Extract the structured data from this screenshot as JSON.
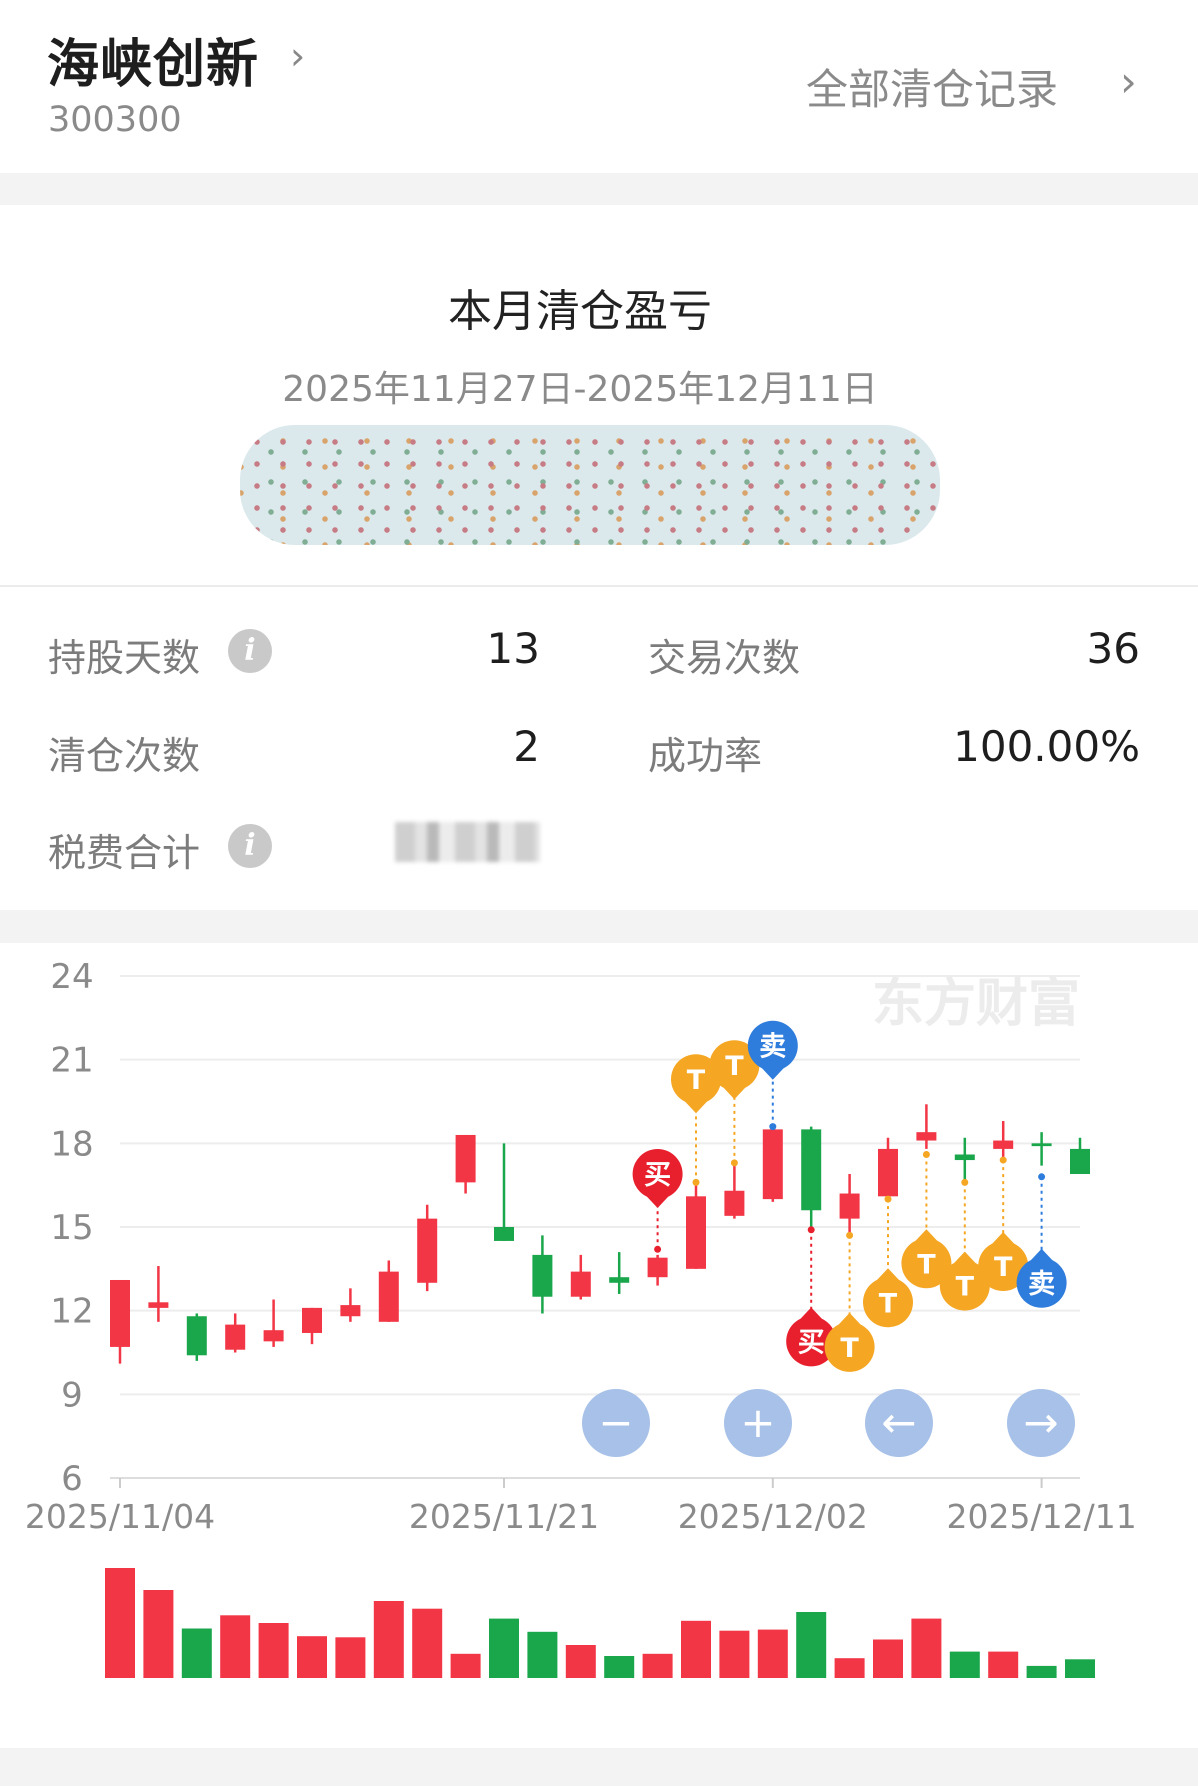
{
  "header": {
    "stock_name": "海峡创新",
    "stock_code": "300300",
    "all_records_link": "全部清仓记录",
    "chevron": "›"
  },
  "summary": {
    "title": "本月清仓盈亏",
    "date_range": "2025年11月27日-2025年12月11日"
  },
  "stats": {
    "holding_days_label": "持股天数",
    "holding_days": "13",
    "trade_count_label": "交易次数",
    "trade_count": "36",
    "clear_count_label": "清仓次数",
    "clear_count": "2",
    "success_rate_label": "成功率",
    "success_rate": "100.00%",
    "fees_label": "税费合计",
    "info_icon": "i"
  },
  "chart": {
    "watermark": "东方财富",
    "buy_label": "买",
    "sell_label": "卖",
    "t_label": "T",
    "colors": {
      "up": "#f23645",
      "down": "#1aa64b",
      "buy": "#e8202e",
      "sell": "#2e7cdc",
      "t": "#f5a623",
      "control": "#a7c1e8"
    },
    "controls": [
      {
        "name": "zoom-out-icon",
        "glyph": "−"
      },
      {
        "name": "zoom-in-icon",
        "glyph": "+"
      },
      {
        "name": "arrow-left-icon",
        "glyph": "←"
      },
      {
        "name": "arrow-right-icon",
        "glyph": "→"
      }
    ]
  },
  "chart_data": {
    "type": "candlestick",
    "ylim": [
      6,
      24
    ],
    "y_ticks": [
      24,
      21,
      18,
      15,
      12,
      9,
      6
    ],
    "x_tick_labels": [
      {
        "index": 0,
        "label": "2025/11/04"
      },
      {
        "index": 10,
        "label": "2025/11/21"
      },
      {
        "index": 17,
        "label": "2025/12/02"
      },
      {
        "index": 24,
        "label": "2025/12/11"
      }
    ],
    "candles": [
      {
        "o": 10.7,
        "c": 13.1,
        "h": 13.1,
        "l": 10.1
      },
      {
        "o": 12.1,
        "c": 12.3,
        "h": 13.6,
        "l": 11.6
      },
      {
        "o": 11.8,
        "c": 10.4,
        "h": 11.9,
        "l": 10.2
      },
      {
        "o": 10.6,
        "c": 11.5,
        "h": 11.9,
        "l": 10.5
      },
      {
        "o": 10.9,
        "c": 11.3,
        "h": 12.4,
        "l": 10.7
      },
      {
        "o": 11.2,
        "c": 12.1,
        "h": 12.1,
        "l": 10.8
      },
      {
        "o": 11.8,
        "c": 12.2,
        "h": 12.8,
        "l": 11.6
      },
      {
        "o": 11.6,
        "c": 13.4,
        "h": 13.8,
        "l": 11.6
      },
      {
        "o": 13.0,
        "c": 15.3,
        "h": 15.8,
        "l": 12.7
      },
      {
        "o": 16.6,
        "c": 18.3,
        "h": 18.3,
        "l": 16.2
      },
      {
        "o": 15.0,
        "c": 14.5,
        "h": 18.0,
        "l": 14.5
      },
      {
        "o": 14.0,
        "c": 12.5,
        "h": 14.7,
        "l": 11.9
      },
      {
        "o": 12.5,
        "c": 13.4,
        "h": 14.0,
        "l": 12.4
      },
      {
        "o": 13.2,
        "c": 13.0,
        "h": 14.1,
        "l": 12.6
      },
      {
        "o": 13.2,
        "c": 13.9,
        "h": 14.0,
        "l": 12.9
      },
      {
        "o": 13.5,
        "c": 16.1,
        "h": 16.6,
        "l": 13.5
      },
      {
        "o": 15.4,
        "c": 16.3,
        "h": 17.3,
        "l": 15.3
      },
      {
        "o": 16.0,
        "c": 18.5,
        "h": 18.7,
        "l": 15.9
      },
      {
        "o": 18.5,
        "c": 15.6,
        "h": 18.6,
        "l": 14.8
      },
      {
        "o": 15.3,
        "c": 16.2,
        "h": 16.9,
        "l": 14.6
      },
      {
        "o": 16.1,
        "c": 17.8,
        "h": 18.2,
        "l": 15.9
      },
      {
        "o": 18.1,
        "c": 18.4,
        "h": 19.4,
        "l": 17.8
      },
      {
        "o": 17.6,
        "c": 17.4,
        "h": 18.2,
        "l": 16.6
      },
      {
        "o": 17.8,
        "c": 18.1,
        "h": 18.8,
        "l": 17.5
      },
      {
        "o": 18.0,
        "c": 17.9,
        "h": 18.4,
        "l": 17.2
      },
      {
        "o": 17.8,
        "c": 16.9,
        "h": 18.2,
        "l": 16.9
      }
    ],
    "volumes": [
      100,
      80,
      45,
      57,
      50,
      38,
      37,
      70,
      63,
      22,
      54,
      42,
      30,
      20,
      22,
      52,
      43,
      44,
      60,
      18,
      35,
      54,
      24,
      24,
      11,
      17
    ],
    "trades": [
      {
        "index": 14,
        "type": "buy",
        "price": 14.2,
        "y": 16.9
      },
      {
        "index": 15,
        "type": "t",
        "price": 16.6,
        "y": 20.3
      },
      {
        "index": 16,
        "type": "t",
        "price": 17.3,
        "y": 20.8
      },
      {
        "index": 17,
        "type": "sell",
        "price": 18.6,
        "y": 21.5
      },
      {
        "index": 18,
        "type": "buy",
        "price": 14.9,
        "y": 10.9
      },
      {
        "index": 19,
        "type": "t",
        "price": 14.7,
        "y": 10.7
      },
      {
        "index": 20,
        "type": "t",
        "price": 16.0,
        "y": 12.3
      },
      {
        "index": 21,
        "type": "t",
        "price": 17.6,
        "y": 13.7
      },
      {
        "index": 22,
        "type": "t",
        "price": 16.6,
        "y": 12.9
      },
      {
        "index": 23,
        "type": "t",
        "price": 17.4,
        "y": 13.6
      },
      {
        "index": 24,
        "type": "sell",
        "price": 16.8,
        "y": 13.0
      }
    ]
  }
}
